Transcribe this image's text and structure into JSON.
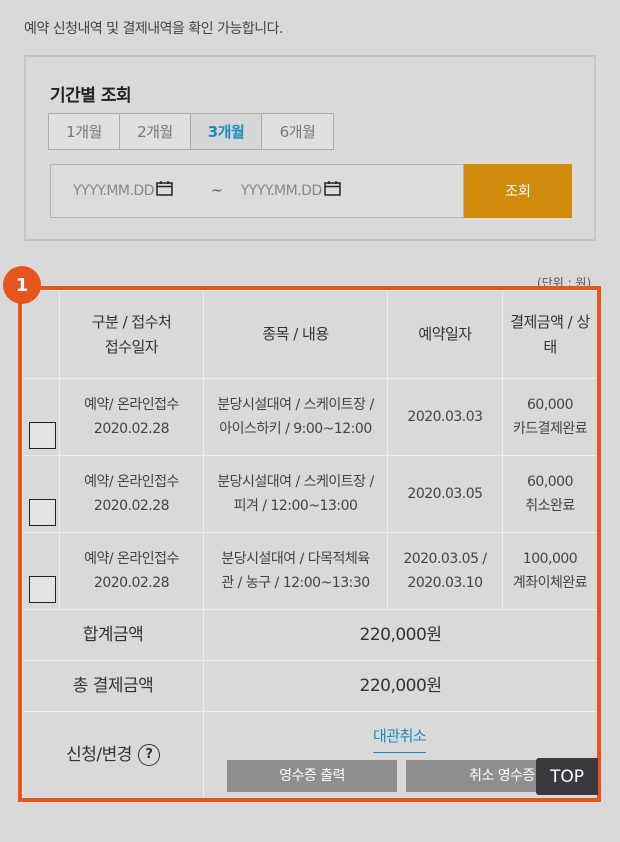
{
  "intro_text": "예약 신청내역 및 결제내역을 확인 가능합니다.",
  "search": {
    "title": "기간별 조회",
    "periods": [
      "1개월",
      "2개월",
      "3개월",
      "6개월"
    ],
    "active_period": "3개월",
    "start_placeholder": "YYYY.MM.DD",
    "end_placeholder": "YYYY.MM.DD",
    "separator": "~",
    "button_label": "조회",
    "button_color": "#d08a0c"
  },
  "unit_label": "(단위 : 원)",
  "badge_number": "1",
  "table": {
    "headers": {
      "category_line1": "구분 / 접수처",
      "category_line2": "접수일자",
      "item": "종목 / 내용",
      "reservation_date": "예약일자",
      "payment_line1": "결제금액 / 상",
      "payment_line2": "태"
    },
    "rows": [
      {
        "category": "예약/ 온라인접수",
        "received": "2020.02.28",
        "item_line1": "분당시설대여 / 스케이트장 /",
        "item_line2": "아이스하키 / 9:00~12:00",
        "date_line1": "2020.03.03",
        "date_line2": "",
        "amount": "60,000",
        "status": "카드결제완료"
      },
      {
        "category": "예약/ 온라인접수",
        "received": "2020.02.28",
        "item_line1": "분당시설대여 / 스케이트장 /",
        "item_line2": "피겨 / 12:00~13:00",
        "date_line1": "2020.03.05",
        "date_line2": "",
        "amount": "60,000",
        "status": "취소완료"
      },
      {
        "category": "예약/ 온라인접수",
        "received": "2020.02.28",
        "item_line1": "분당시설대여 / 다목적체육",
        "item_line2": "관 / 농구 / 12:00~13:30",
        "date_line1": "2020.03.05 /",
        "date_line2": "2020.03.10",
        "amount": "100,000",
        "status": "계좌이체완료"
      }
    ],
    "sum_label": "합계금액",
    "sum_value": "220,000원",
    "total_label": "총 결제금액",
    "total_value": "220,000원",
    "total_color": "#e0521b",
    "apply_label": "신청/변경",
    "help_glyph": "?",
    "cancel_link": "대관취소",
    "receipt_button": "영수증 출력",
    "cancel_receipt_button": "취소 영수증"
  },
  "top_button": "TOP",
  "highlight_color": "#e8541d"
}
